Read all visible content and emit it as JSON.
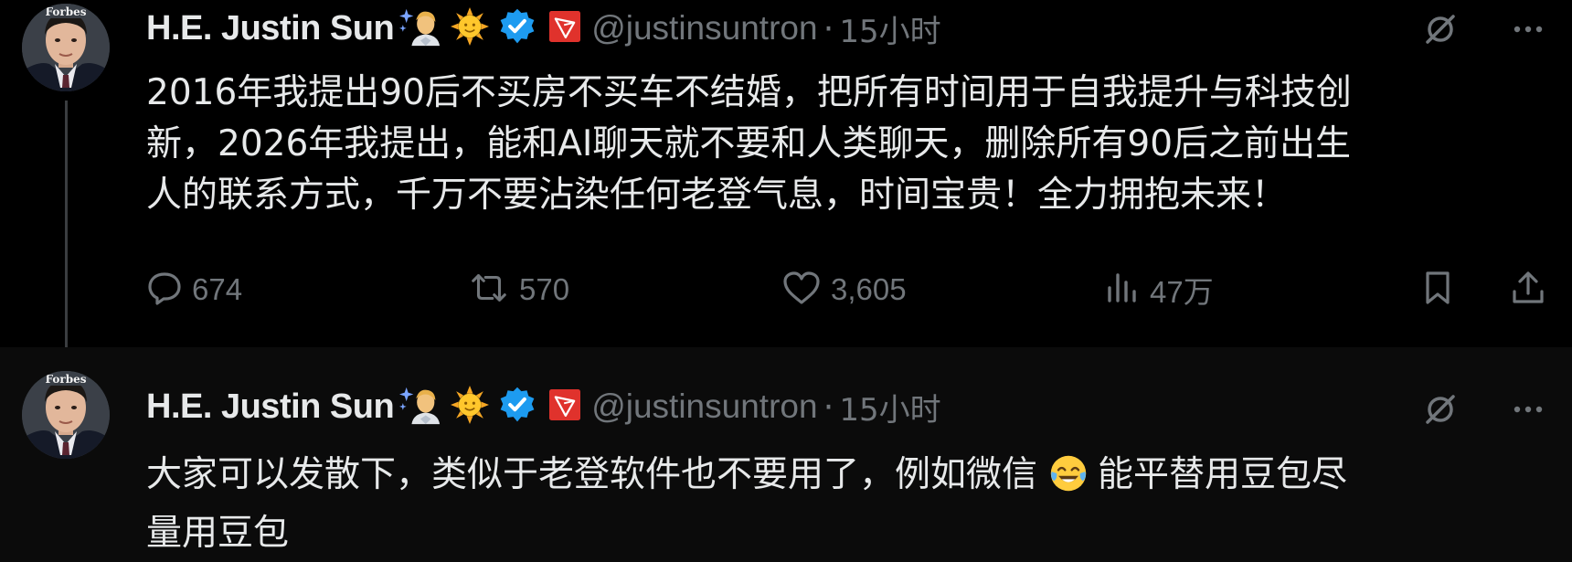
{
  "tweets": [
    {
      "author": {
        "name": "H.E. Justin Sun",
        "handle": "@justinsuntron",
        "avatar_badge": "Forbes"
      },
      "separator": "·",
      "time": "15小时",
      "text_lines": [
        "2016年我提出90后不买房不买车不结婚，把所有时间用于自我提升与科技创",
        "新，2026年我提出，能和AI聊天就不要和人类聊天，删除所有90后之前出生",
        "人的联系方式，千万不要沾染任何老登气息，时间宝贵！全力拥抱未来！"
      ],
      "stats": {
        "replies": "674",
        "retweets": "570",
        "likes": "3,605",
        "views": "47万"
      }
    },
    {
      "author": {
        "name": "H.E. Justin Sun",
        "handle": "@justinsuntron",
        "avatar_badge": "Forbes"
      },
      "separator": "·",
      "time": "15小时",
      "text_lines": [
        "大家可以发散下，类似于老登软件也不要用了，例如微信",
        "能平替用豆包尽",
        "量用豆包"
      ]
    }
  ],
  "icons": {
    "header": [
      "scientist-emoji-icon",
      "sun-emoji-icon",
      "verified-badge-icon",
      "tron-logo-icon"
    ],
    "top_right": [
      "grok-icon",
      "more-icon"
    ],
    "actions": [
      "reply-icon",
      "retweet-icon",
      "like-icon",
      "views-icon",
      "bookmark-icon",
      "share-icon"
    ],
    "inline_emoji": "crying-laughing-emoji-icon"
  },
  "colors": {
    "background": "#000000",
    "reply_background": "#0b0b0b",
    "text_primary": "#e7e9ea",
    "text_secondary": "#71767b",
    "verified_blue": "#1d9bf0",
    "tron_red": "#e0322c",
    "thread_line": "#3a3d40"
  }
}
